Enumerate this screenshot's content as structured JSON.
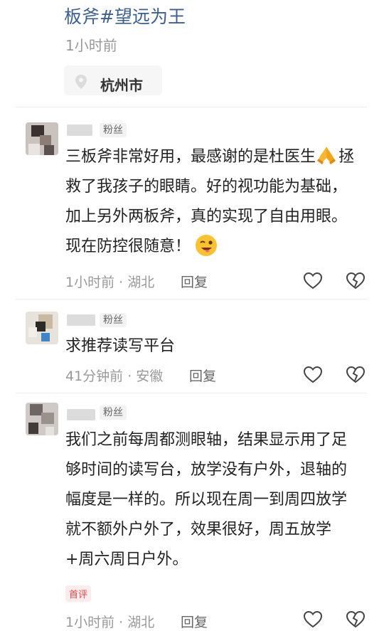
{
  "post": {
    "hashtag": "板斧#望远为王",
    "time": "1小时前",
    "location": "杭州市"
  },
  "colors": {
    "link": "#3d5f8f",
    "meta": "#999999",
    "first_badge": "#e8434a"
  },
  "comments": [
    {
      "badge": "粉丝",
      "text_part1": "三板斧非常好用，最感谢的是杜医生",
      "text_part2": "拯救了我孩子的眼睛。好的视功能为基础，加上另外两板斧，真的实现了自由用眼。现在防控很随意！",
      "meta": "1小时前 · 湖北",
      "reply": "回复"
    },
    {
      "badge": "粉丝",
      "text": "求推荐读写平台",
      "meta": "41分钟前 · 安徽",
      "reply": "回复"
    },
    {
      "badge": "粉丝",
      "text": "我们之前每周都测眼轴，结果显示用了足够时间的读写台，放学没有户外，退轴的幅度是一样的。所以现在周一到周四放学就不额外户外了，效果很好，周五放学+周六周日户外。",
      "first_label": "首评",
      "meta": "1小时前 · 湖北",
      "reply": "回复"
    }
  ],
  "icons": [
    "location-pin-icon",
    "heart-icon",
    "broken-heart-icon",
    "praying-hands-emoji",
    "winking-face-emoji"
  ]
}
